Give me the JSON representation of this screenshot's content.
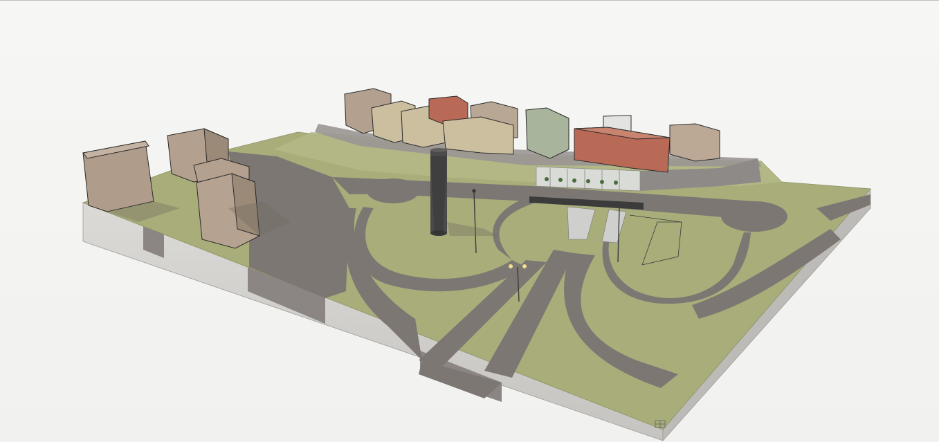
{
  "scene": {
    "kind": "3d-site-model",
    "colors": {
      "ground_green": "#a8ad7a",
      "ground_green_light": "#b4b987",
      "road": "#7d7774",
      "road_dark": "#6c6663",
      "base_side": "#d4d2ce",
      "base_side_dark": "#b9b7b3",
      "building_tan": "#b3a08e",
      "building_cream": "#cbbf9f",
      "building_red": "#b96a56",
      "building_green": "#a8b49c",
      "building_white": "#e3e3e1",
      "background": "#f4f4f2"
    },
    "nav_icon": "grid-cube-icon"
  }
}
